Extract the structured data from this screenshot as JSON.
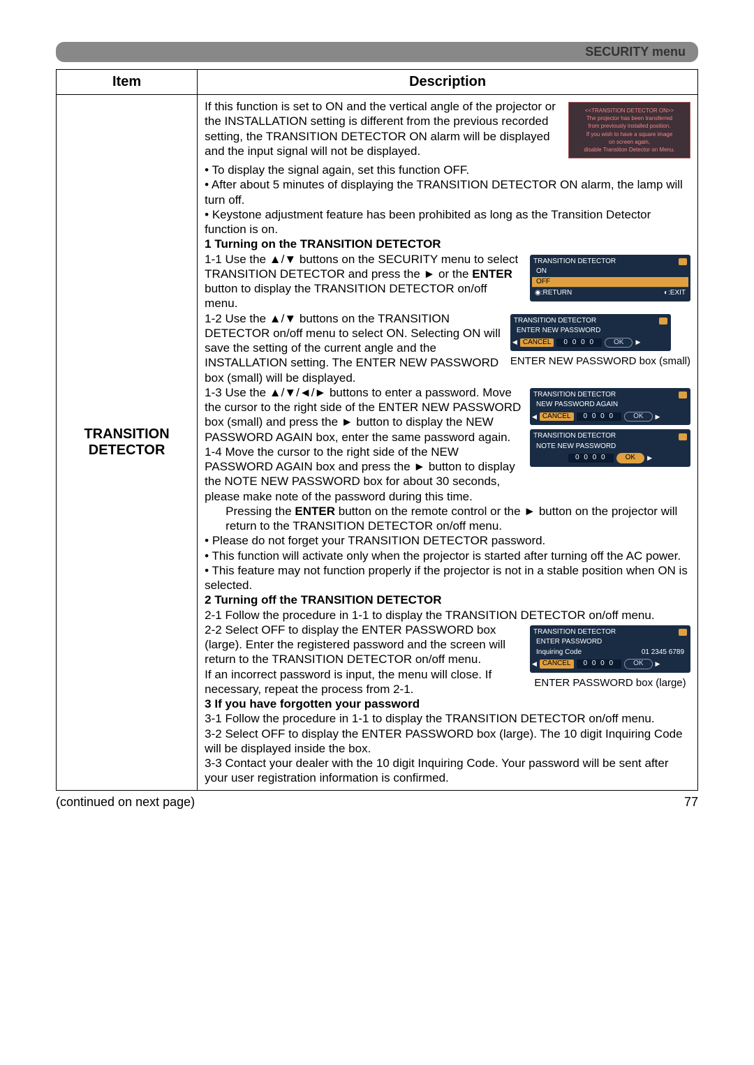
{
  "header": {
    "label": "SECURITY menu"
  },
  "table": {
    "col_item": "Item",
    "col_desc": "Description",
    "item_name": "TRANSITION DETECTOR"
  },
  "alarm": {
    "title": "<<TRANSITION DETECTOR ON>>",
    "l1": "The projector has been transferred",
    "l2": "from previously installed position.",
    "l3": "If you wish to have a square image",
    "l4": "on screen again,",
    "l5": "disable Transition Detector on Menu."
  },
  "para1_a": "If this function is set to ON and the vertical angle of the projector or the INSTALLATION setting is different from the previous recorded setting, the TRANSITION DETECTOR ON alarm will be displayed and the input signal will not be displayed.",
  "para1_b": "• To display the signal again, set this function OFF.",
  "para1_c": "• After about 5 minutes of displaying the TRANSITION DETECTOR ON alarm, the lamp will turn off.",
  "para1_d": "• Keystone adjustment feature has been prohibited as long as the Transition Detector function is on.",
  "sec1_title": "1 Turning on the TRANSITION DETECTOR",
  "sec1_1a": "1-1 Use the ▲/▼ buttons on the SECURITY menu to select TRANSITION DETECTOR and press the ► or the ",
  "sec1_1_enter": "ENTER",
  "sec1_1b": " button to display the TRANSITION DETECTOR on/off menu.",
  "sec1_2": "1-2 Use the ▲/▼ buttons on the TRANSITION DETECTOR on/off menu to select ON. Selecting ON will save the setting of the current angle and the INSTALLATION setting. The ENTER NEW PASSWORD box (small) will be displayed.",
  "sec1_3": "1-3 Use the ▲/▼/◄/► buttons to enter a password. Move the cursor to the right side of the ENTER NEW PASSWORD box (small) and press the ► button to display the NEW PASSWORD AGAIN box, enter the same password again.",
  "sec1_4": "1-4 Move the cursor to the right side of the NEW PASSWORD AGAIN box and press the ► button to display the NOTE NEW PASSWORD box for about 30 seconds, please make note of the password during this time.",
  "sec1_5a": "Pressing the ",
  "sec1_5_enter": "ENTER",
  "sec1_5b": " button on the remote control or the ► button on the projector will return to the TRANSITION DETECTOR on/off menu.",
  "sec1_6": "• Please do not forget your TRANSITION DETECTOR password.",
  "sec1_7": "• This function will activate only when the projector is started after turning off the AC power.",
  "sec1_8": "• This feature may not function properly if the projector is not in a stable position when ON is selected.",
  "sec2_title": "2 Turning off the TRANSITION DETECTOR",
  "sec2_1": "2-1 Follow the procedure in 1-1 to display the TRANSITION DETECTOR on/off menu.",
  "sec2_2": "2-2 Select OFF to display the ENTER PASSWORD box (large). Enter the registered password and the screen will return to the TRANSITION DETECTOR on/off menu.",
  "sec2_3": "If an incorrect password is input, the menu will close. If necessary, repeat the process from 2-1.",
  "sec3_title": "3 If you have forgotten your password",
  "sec3_1": "3-1 Follow the procedure in 1-1 to display the TRANSITION DETECTOR on/off menu.",
  "sec3_2": "3-2 Select OFF to display the ENTER PASSWORD box (large). The 10 digit Inquiring Code will be displayed inside the box.",
  "sec3_3": "3-3 Contact your dealer with the 10 digit Inquiring Code. Your password will be sent after your user registration information is confirmed.",
  "osd_onoff": {
    "title": "TRANSITION DETECTOR",
    "on": "ON",
    "off": "OFF",
    "return": "◉:RETURN",
    "exit": "◐:EXIT"
  },
  "osd_newpw": {
    "title": "TRANSITION DETECTOR",
    "label": "ENTER NEW PASSWORD",
    "cancel": "CANCEL",
    "digits": "0 0 0 0",
    "ok": "OK",
    "caption": "ENTER NEW PASSWORD box (small)"
  },
  "osd_again": {
    "title": "TRANSITION DETECTOR",
    "label": "NEW PASSWORD AGAIN",
    "cancel": "CANCEL",
    "digits": "0 0 0 0",
    "ok": "OK"
  },
  "osd_note": {
    "title": "TRANSITION DETECTOR",
    "label": "NOTE NEW PASSWORD",
    "digits": "0 0 0 0",
    "ok": "OK"
  },
  "osd_enterpw": {
    "title": "TRANSITION DETECTOR",
    "label": "ENTER PASSWORD",
    "inq_label": "Inquiring Code",
    "inq_code": "01 2345 6789",
    "cancel": "CANCEL",
    "digits": "0 0 0 0",
    "ok": "OK",
    "caption": "ENTER PASSWORD box (large)"
  },
  "footer": {
    "continued": "(continued on next page)",
    "page": "77"
  }
}
